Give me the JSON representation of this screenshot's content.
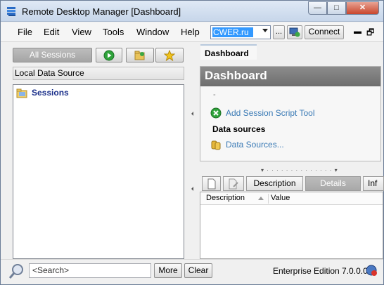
{
  "window": {
    "title": "Remote Desktop Manager [Dashboard]"
  },
  "menu": {
    "items": [
      "File",
      "Edit",
      "View",
      "Tools",
      "Window",
      "Help"
    ],
    "datasource_combo": "CWER.ru",
    "dots_label": "...",
    "connect_label": "Connect"
  },
  "left": {
    "all_sessions_label": "All Sessions",
    "data_source_label": "Local Data Source",
    "tree": [
      {
        "label": "Sessions",
        "icon": "folder-icon"
      }
    ]
  },
  "right": {
    "tab_label": "Dashboard",
    "dashboard_title": "Dashboard",
    "placeholder_dash": "-",
    "add_script_link": "Add Session Script Tool",
    "data_sources_heading": "Data sources",
    "data_sources_link": "Data Sources...",
    "bottom_tabs": [
      "Description",
      "Details",
      "Inf"
    ],
    "grid_columns": [
      "Description",
      "Value"
    ]
  },
  "status": {
    "search_placeholder": "<Search>",
    "more_label": "More",
    "clear_label": "Clear",
    "edition": "Enterprise Edition 7.0.0.0"
  },
  "colors": {
    "link": "#3a7ab5",
    "tree_label": "#1a2f8a",
    "selection": "#3399ff"
  }
}
